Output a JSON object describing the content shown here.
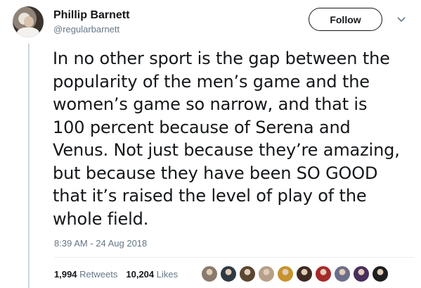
{
  "author": {
    "name": "Phillip Barnett",
    "handle": "@regularbarnett"
  },
  "follow_label": "Follow",
  "tweet_lines": [
    "In no other sport is the gap between the",
    "popularity of the men’s game and the",
    "women’s game so narrow, and that is",
    "100 percent because of Serena and",
    "Venus. Not just because they’re amazing,",
    "but because they have been SO GOOD",
    "that it’s raised the level of play of the",
    "whole field."
  ],
  "timestamp": "8:39 AM - 24 Aug 2018",
  "stats": {
    "retweets_count": "1,994",
    "retweets_label": "Retweets",
    "likes_count": "10,204",
    "likes_label": "Likes"
  },
  "liker_avatars": [
    {
      "icon": "liker-avatar",
      "color": "#8a7a6b"
    },
    {
      "icon": "liker-avatar",
      "color": "#2f3a44"
    },
    {
      "icon": "liker-avatar",
      "color": "#5a4632"
    },
    {
      "icon": "liker-avatar",
      "color": "#b7a08a"
    },
    {
      "icon": "liker-avatar",
      "color": "#c6932f"
    },
    {
      "icon": "liker-avatar",
      "color": "#3d2b22"
    },
    {
      "icon": "liker-avatar",
      "color": "#a52a2a"
    },
    {
      "icon": "liker-avatar",
      "color": "#6b6f8a"
    },
    {
      "icon": "liker-avatar",
      "color": "#4a2f5c"
    },
    {
      "icon": "liker-avatar",
      "color": "#1f1f1f"
    }
  ]
}
